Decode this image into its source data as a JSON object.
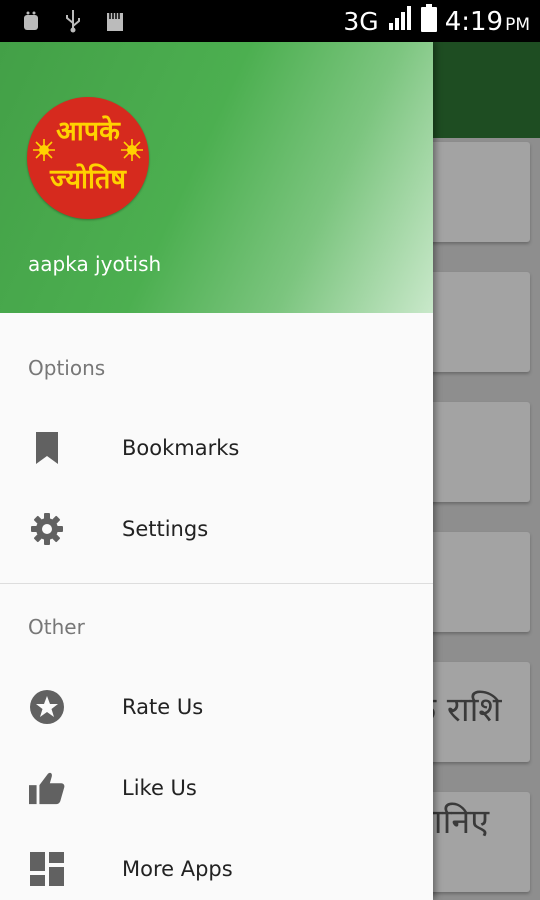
{
  "status_bar": {
    "network": "3G",
    "time": "4:19",
    "ampm": "PM",
    "left_icons": [
      "android-debug-icon",
      "usb-icon",
      "sd-card-icon"
    ]
  },
  "background": {
    "text_1": "क राशि",
    "text_2": "ज्ञानिए"
  },
  "drawer": {
    "logo": {
      "line1": "आपके",
      "line2": "ज्योतिष"
    },
    "app_name": "aapka jyotish",
    "sections": {
      "options_label": "Options",
      "other_label": "Other"
    },
    "items": [
      {
        "label": "Bookmarks",
        "icon": "bookmark-icon"
      },
      {
        "label": "Settings",
        "icon": "gear-icon"
      },
      {
        "label": "Rate Us",
        "icon": "star-circle-icon"
      },
      {
        "label": "Like Us",
        "icon": "thumbs-up-icon"
      },
      {
        "label": "More Apps",
        "icon": "dashboard-grid-icon"
      }
    ]
  },
  "colors": {
    "header_green": "#4caf50",
    "logo_red": "#d62a1e",
    "logo_text": "#ffd200",
    "dark_toolbar": "#1e4d22"
  }
}
